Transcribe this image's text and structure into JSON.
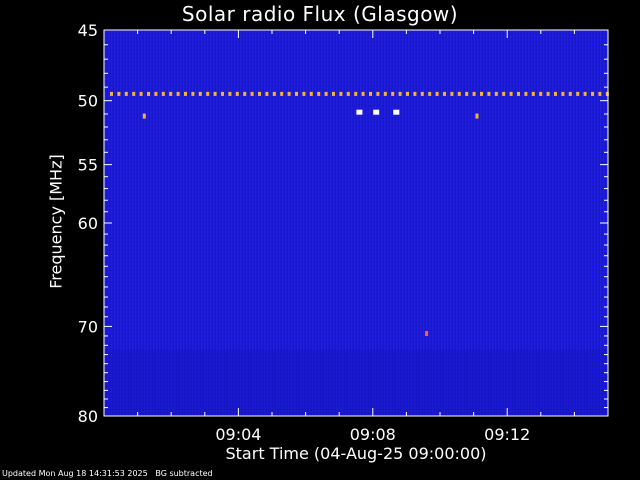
{
  "chart_data": {
    "type": "heatmap",
    "title": "Solar radio Flux (Glasgow)",
    "xlabel": "Start Time (04-Aug-25 09:00:00)",
    "ylabel": "Frequency [MHz]",
    "x_ticks": [
      "09:04",
      "09:08",
      "09:12"
    ],
    "x_tick_minutes": [
      4,
      8,
      12
    ],
    "xlim_minutes": [
      0,
      15
    ],
    "y_ticks": [
      45,
      50,
      55,
      60,
      70,
      80
    ],
    "ylim": [
      45,
      80
    ],
    "y_scale": "log",
    "y_inverted": true,
    "background_color": "#1a1ad6",
    "hot_pixel_color": "#ffb030",
    "bright_pixel_color": "#ffffff",
    "interference_line_mhz": 49.5,
    "bright_features": [
      {
        "minute": 1.2,
        "mhz": 51.2,
        "color": "#ffb030"
      },
      {
        "minute": 7.6,
        "mhz": 50.9,
        "color": "#ffffff"
      },
      {
        "minute": 8.1,
        "mhz": 50.9,
        "color": "#ffffff"
      },
      {
        "minute": 8.7,
        "mhz": 50.9,
        "color": "#ffffff"
      },
      {
        "minute": 11.1,
        "mhz": 51.2,
        "color": "#ffb030"
      },
      {
        "minute": 9.6,
        "mhz": 70.8,
        "color": "#ff6040"
      }
    ]
  },
  "footer": "Updated Mon Aug 18 14:31:53 2025   BG subtracted"
}
